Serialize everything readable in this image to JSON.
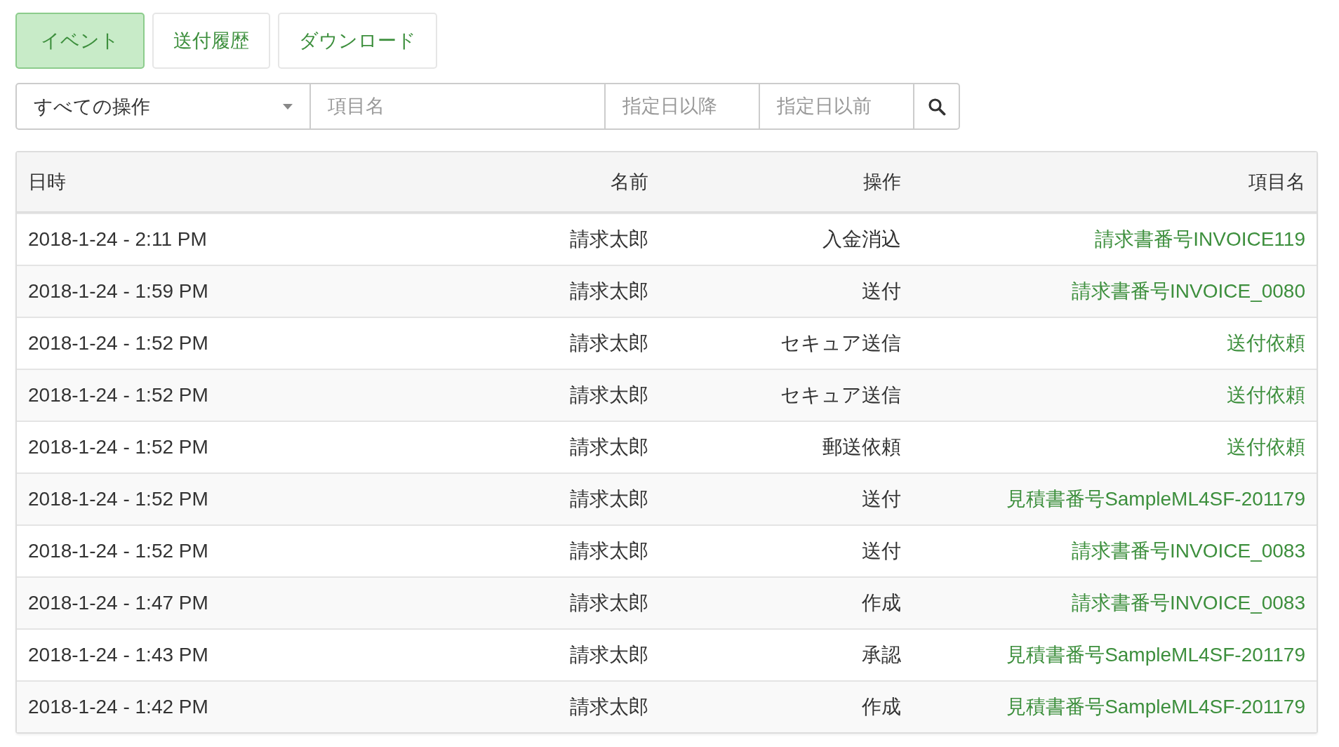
{
  "tabs": [
    {
      "label": "イベント",
      "selected": true
    },
    {
      "label": "送付履歴",
      "selected": false
    },
    {
      "label": "ダウンロード",
      "selected": false
    }
  ],
  "filters": {
    "operation_select": "すべての操作",
    "item_name": {
      "placeholder": "項目名"
    },
    "date_from": {
      "placeholder": "指定日以降"
    },
    "date_to": {
      "placeholder": "指定日以前"
    }
  },
  "table": {
    "columns": [
      "日時",
      "名前",
      "操作",
      "項目名"
    ],
    "rows": [
      {
        "datetime": "2018-1-24 - 2:11 PM",
        "name": "請求太郎",
        "operation": "入金消込",
        "item": "請求書番号INVOICE119"
      },
      {
        "datetime": "2018-1-24 - 1:59 PM",
        "name": "請求太郎",
        "operation": "送付",
        "item": "請求書番号INVOICE_0080"
      },
      {
        "datetime": "2018-1-24 - 1:52 PM",
        "name": "請求太郎",
        "operation": "セキュア送信",
        "item": "送付依頼"
      },
      {
        "datetime": "2018-1-24 - 1:52 PM",
        "name": "請求太郎",
        "operation": "セキュア送信",
        "item": "送付依頼"
      },
      {
        "datetime": "2018-1-24 - 1:52 PM",
        "name": "請求太郎",
        "operation": "郵送依頼",
        "item": "送付依頼"
      },
      {
        "datetime": "2018-1-24 - 1:52 PM",
        "name": "請求太郎",
        "operation": "送付",
        "item": "見積書番号SampleML4SF-201179"
      },
      {
        "datetime": "2018-1-24 - 1:52 PM",
        "name": "請求太郎",
        "operation": "送付",
        "item": "請求書番号INVOICE_0083"
      },
      {
        "datetime": "2018-1-24 - 1:47 PM",
        "name": "請求太郎",
        "operation": "作成",
        "item": "請求書番号INVOICE_0083"
      },
      {
        "datetime": "2018-1-24 - 1:43 PM",
        "name": "請求太郎",
        "operation": "承認",
        "item": "見積書番号SampleML4SF-201179"
      },
      {
        "datetime": "2018-1-24 - 1:42 PM",
        "name": "請求太郎",
        "operation": "作成",
        "item": "見積書番号SampleML4SF-201179"
      }
    ]
  }
}
